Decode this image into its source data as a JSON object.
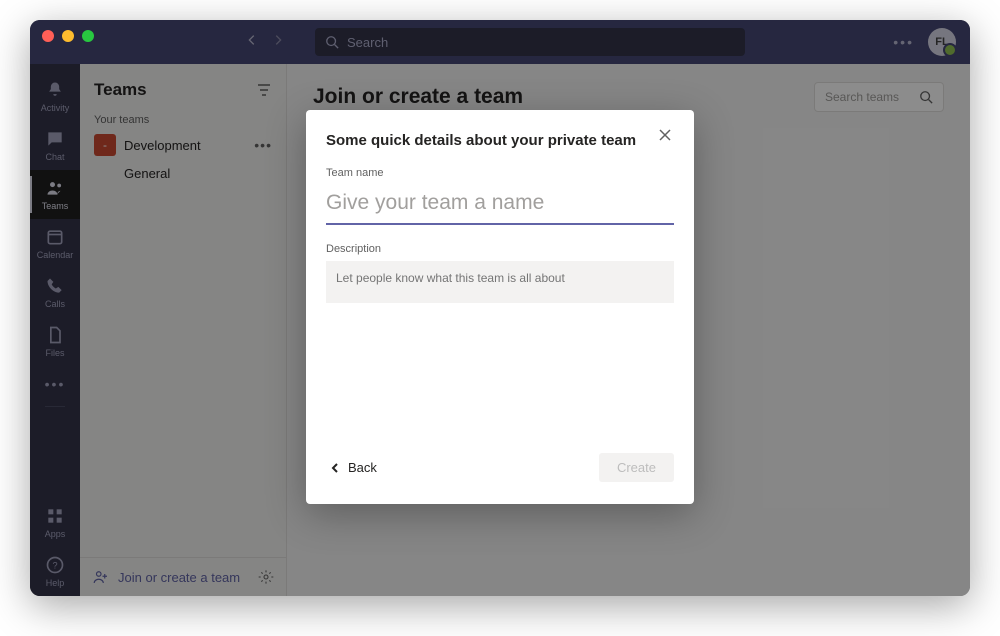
{
  "titlebar": {
    "search_placeholder": "Search",
    "avatar_initials": "FL"
  },
  "rail": {
    "items": [
      {
        "label": "Activity"
      },
      {
        "label": "Chat"
      },
      {
        "label": "Teams"
      },
      {
        "label": "Calendar"
      },
      {
        "label": "Calls"
      },
      {
        "label": "Files"
      }
    ],
    "bottom": [
      {
        "label": "Apps"
      },
      {
        "label": "Help"
      }
    ]
  },
  "panel": {
    "title": "Teams",
    "your_teams_label": "Your teams",
    "team": {
      "name": "Development",
      "initial": "-"
    },
    "channel": "General",
    "join_label": "Join or create a team"
  },
  "main": {
    "title": "Join or create a team",
    "search_placeholder": "Search teams"
  },
  "modal": {
    "title": "Some quick details about your private team",
    "name_label": "Team name",
    "name_placeholder": "Give your team a name",
    "desc_label": "Description",
    "desc_placeholder": "Let people know what this team is all about",
    "back_label": "Back",
    "create_label": "Create"
  }
}
